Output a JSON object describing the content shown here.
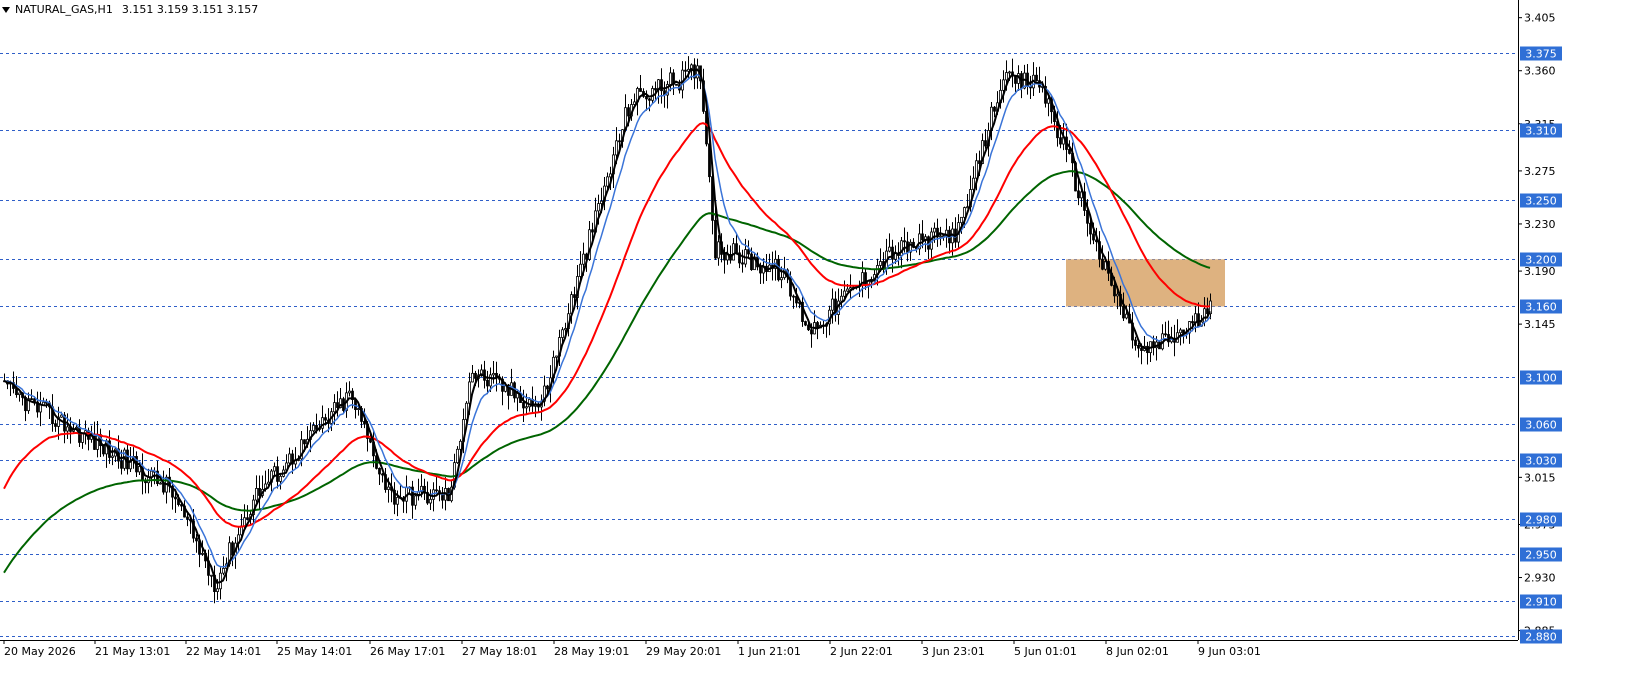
{
  "header": {
    "symbol_text": "NATURAL_GAS,H1",
    "ohlc_text": "3.151 3.159 3.151 3.157"
  },
  "colors": {
    "background": "#ffffff",
    "candles": "#000000",
    "ma_fast": "#000000",
    "ma_blue": "#3a74d8",
    "ma_red": "#ff0000",
    "ma_green": "#006400",
    "hline": "#2f5fc8",
    "level_label_bg": "#2f6fd6",
    "level_label_text": "#ffffff",
    "zone_fill": "#d8a56a"
  },
  "chart_data": {
    "type": "candlestick",
    "y_axis_ticks": [
      "3.405",
      "3.360",
      "3.315",
      "3.275",
      "3.230",
      "3.190",
      "3.145",
      "3.015",
      "2.975",
      "2.930",
      "2.885"
    ],
    "x_axis_ticks": [
      "20 May 2026",
      "21 May 13:01",
      "22 May 14:01",
      "25 May 14:01",
      "26 May 17:01",
      "27 May 18:01",
      "28 May 19:01",
      "29 May 20:01",
      "1 Jun 21:01",
      "2 Jun 22:01",
      "3 Jun 23:01",
      "5 Jun 01:01",
      "8 Jun 02:01",
      "9 Jun 03:01"
    ],
    "ylim": [
      2.877,
      3.42
    ],
    "horizontal_levels": [
      "3.375",
      "3.310",
      "3.250",
      "3.200",
      "3.160",
      "3.100",
      "3.060",
      "3.030",
      "2.980",
      "2.950",
      "2.910",
      "2.880"
    ],
    "zone": {
      "price_top": 3.2,
      "price_bottom": 3.16,
      "start_label": "5 Jun 01:01",
      "end_label": "9 Jun 03:01"
    },
    "approx_close_path": [
      [
        "20 May 2026",
        3.09
      ],
      [
        "21 May 13:01",
        3.045
      ],
      [
        "22 May 14:01",
        2.99
      ],
      [
        "22 May 14:01",
        2.92
      ],
      [
        "25 May 14:01",
        3.005
      ],
      [
        "25 May 14:01",
        3.045
      ],
      [
        "26 May 17:01",
        3.08
      ],
      [
        "26 May 17:01",
        2.995
      ],
      [
        "27 May 18:01",
        3.11
      ],
      [
        "27 May 18:01",
        3.075
      ],
      [
        "28 May 19:01",
        3.29
      ],
      [
        "29 May 20:01",
        3.36
      ],
      [
        "1 Jun 21:01",
        3.21
      ],
      [
        "1 Jun 21:01",
        3.19
      ],
      [
        "2 Jun 22:01",
        3.14
      ],
      [
        "2 Jun 22:01",
        3.22
      ],
      [
        "3 Jun 23:01",
        3.225
      ],
      [
        "5 Jun 01:01",
        3.35
      ],
      [
        "8 Jun 02:01",
        3.175
      ],
      [
        "8 Jun 02:01",
        3.12
      ],
      [
        "9 Jun 03:01",
        3.157
      ]
    ]
  }
}
